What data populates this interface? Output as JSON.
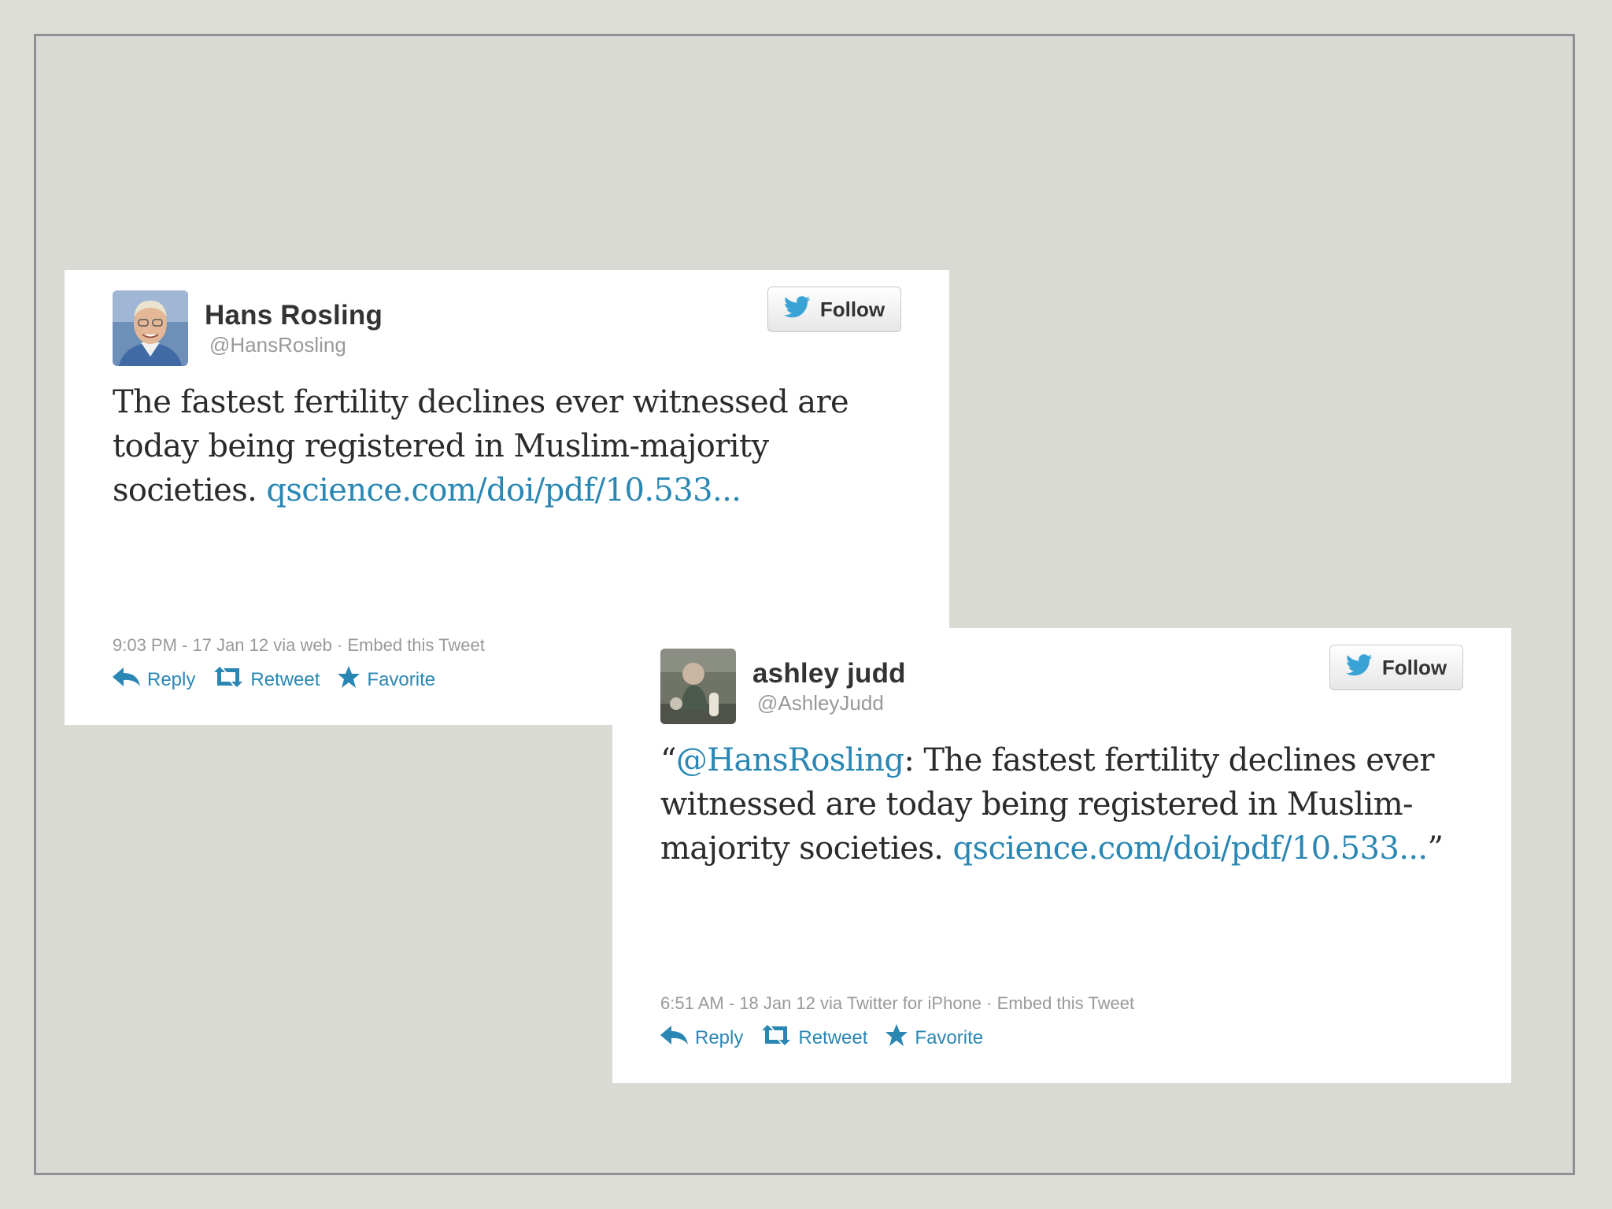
{
  "tweets": [
    {
      "name": "Hans Rosling",
      "handle": "@HansRosling",
      "follow_label": "Follow",
      "text_plain": "The fastest fertility declines ever witnessed are today being registered in Muslim-majority societies. ",
      "link": "qscience.com/doi/pdf/10.533...",
      "meta": "9:03 PM - 17 Jan 12 via web · ",
      "embed": "Embed this Tweet",
      "actions": {
        "reply": "Reply",
        "retweet": "Retweet",
        "favorite": "Favorite"
      },
      "avatar_icon": "portrait-avatar"
    },
    {
      "name": "ashley judd",
      "handle": "@AshleyJudd",
      "follow_label": "Follow",
      "quote_open": "“",
      "mention": "@HansRosling",
      "text_plain": ": The fastest fertility declines ever witnessed are today being registered in Muslim-majority societies. ",
      "link": "qscience.com/doi/pdf/10.533...",
      "quote_close": "”",
      "meta": "6:51 AM - 18 Jan 12 via Twitter for iPhone · ",
      "embed": "Embed this Tweet",
      "actions": {
        "reply": "Reply",
        "retweet": "Retweet",
        "favorite": "Favorite"
      },
      "avatar_icon": "photo-avatar"
    }
  ],
  "colors": {
    "link": "#2a87b3",
    "meta": "#999999",
    "name": "#333333",
    "background": "#dcddd6"
  }
}
